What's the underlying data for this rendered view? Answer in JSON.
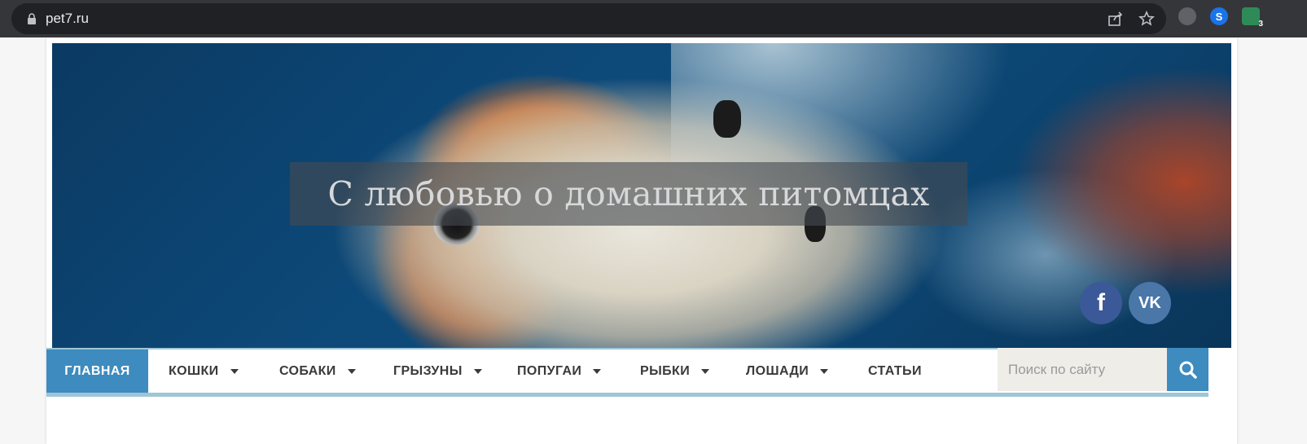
{
  "browser": {
    "url": "pet7.ru",
    "extension_badge": "3"
  },
  "header": {
    "site_title": "С любовью о домашних питомцах"
  },
  "social": [
    {
      "name": "facebook",
      "glyph": "f",
      "color": "#3b5998"
    },
    {
      "name": "vk",
      "glyph": "VK",
      "color": "#4a76a8"
    }
  ],
  "nav": {
    "items": [
      {
        "label": "ГЛАВНАЯ",
        "has_dropdown": false,
        "active": true
      },
      {
        "label": "КОШКИ",
        "has_dropdown": true
      },
      {
        "label": "СОБАКИ",
        "has_dropdown": true
      },
      {
        "label": "ГРЫЗУНЫ",
        "has_dropdown": true
      },
      {
        "label": "ПОПУГАИ",
        "has_dropdown": true
      },
      {
        "label": "РЫБКИ",
        "has_dropdown": true
      },
      {
        "label": "ЛОШАДИ",
        "has_dropdown": true
      },
      {
        "label": "СТАТЬИ",
        "has_dropdown": false
      }
    ],
    "search_placeholder": "Поиск по сайту"
  },
  "colors": {
    "accent": "#3d8bbf",
    "nav_border": "#9ec6d6"
  }
}
